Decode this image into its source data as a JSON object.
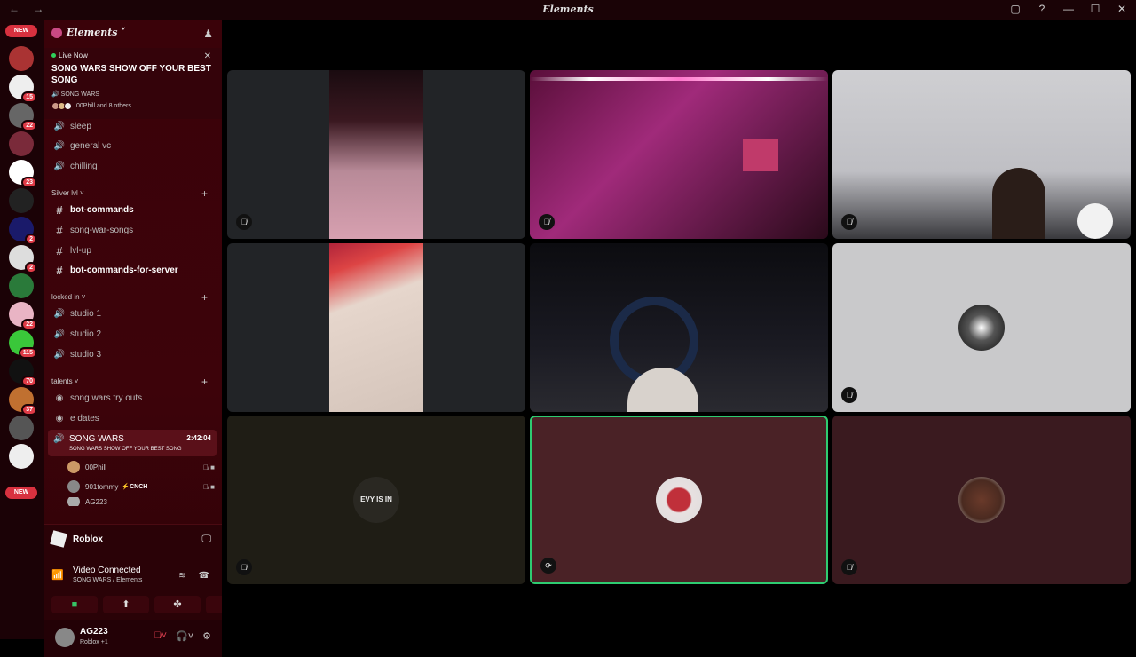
{
  "window": {
    "title": "Elements",
    "nav": "← →",
    "controls": [
      "▢",
      "?",
      "—",
      "☐",
      "✕"
    ]
  },
  "servers": {
    "new_top": "NEW",
    "new_bottom": "NEW",
    "badges": [
      "15",
      "22",
      "23",
      "2",
      "2",
      "22",
      "115",
      "70",
      "37"
    ]
  },
  "guild": {
    "name": "Elements ˅"
  },
  "live": {
    "status": "Live Now",
    "title": "SONG WARS SHOW OFF YOUR BEST SONG",
    "channel": "SONG WARS",
    "users": "00Phill and 8 others",
    "close": "✕"
  },
  "channels_top": [
    {
      "label": "sleep"
    },
    {
      "label": "general vc"
    },
    {
      "label": "chilling"
    }
  ],
  "cat_silver": {
    "label": "Silver lvl ˅"
  },
  "text_channels": [
    {
      "label": "bot-commands"
    },
    {
      "label": "song-war-songs"
    },
    {
      "label": "lvl-up"
    },
    {
      "label": "bot-commands-for-server"
    }
  ],
  "cat_locked": {
    "label": "locked in ˅"
  },
  "studio_channels": [
    {
      "label": "studio 1"
    },
    {
      "label": "studio 2"
    },
    {
      "label": "studio 3"
    }
  ],
  "cat_talents": {
    "label": "talents ˅"
  },
  "talent_channels": [
    {
      "label": "song wars try outs"
    },
    {
      "label": "e dates"
    }
  ],
  "active_channel": {
    "name": "SONG WARS",
    "timer": "2:42:04",
    "subtitle": "SONG WARS SHOW OFF YOUR BEST SONG"
  },
  "voice_users": [
    {
      "name": "00Phill",
      "tag": ""
    },
    {
      "name": "901tommy",
      "tag_icon": "⚡",
      "tag": "CNCH"
    },
    {
      "name": "AG223",
      "tag": ""
    }
  ],
  "game": {
    "name": "Roblox"
  },
  "voice_status": {
    "status": "Video Connected",
    "location": "SONG WARS / Elements"
  },
  "user": {
    "name": "AG223",
    "status": "Roblox +1"
  },
  "colors": {
    "accent_green": "#2ecc71",
    "mute_red": "#e04050",
    "badge_red": "#e03b47"
  },
  "tiles": [
    {
      "id": "tile-1",
      "mute": "mic-off"
    },
    {
      "id": "tile-2",
      "mute": "mic-off"
    },
    {
      "id": "tile-3",
      "mute": "mic-off"
    },
    {
      "id": "tile-4",
      "mute": ""
    },
    {
      "id": "tile-5",
      "mute": ""
    },
    {
      "id": "tile-6",
      "mute": "mic-off"
    },
    {
      "id": "tile-7",
      "mute": "mic-off",
      "avatar_text": "EVY IS IN"
    },
    {
      "id": "tile-8",
      "mute": "stream",
      "speaking": true
    },
    {
      "id": "tile-9",
      "mute": "mic-off"
    }
  ]
}
